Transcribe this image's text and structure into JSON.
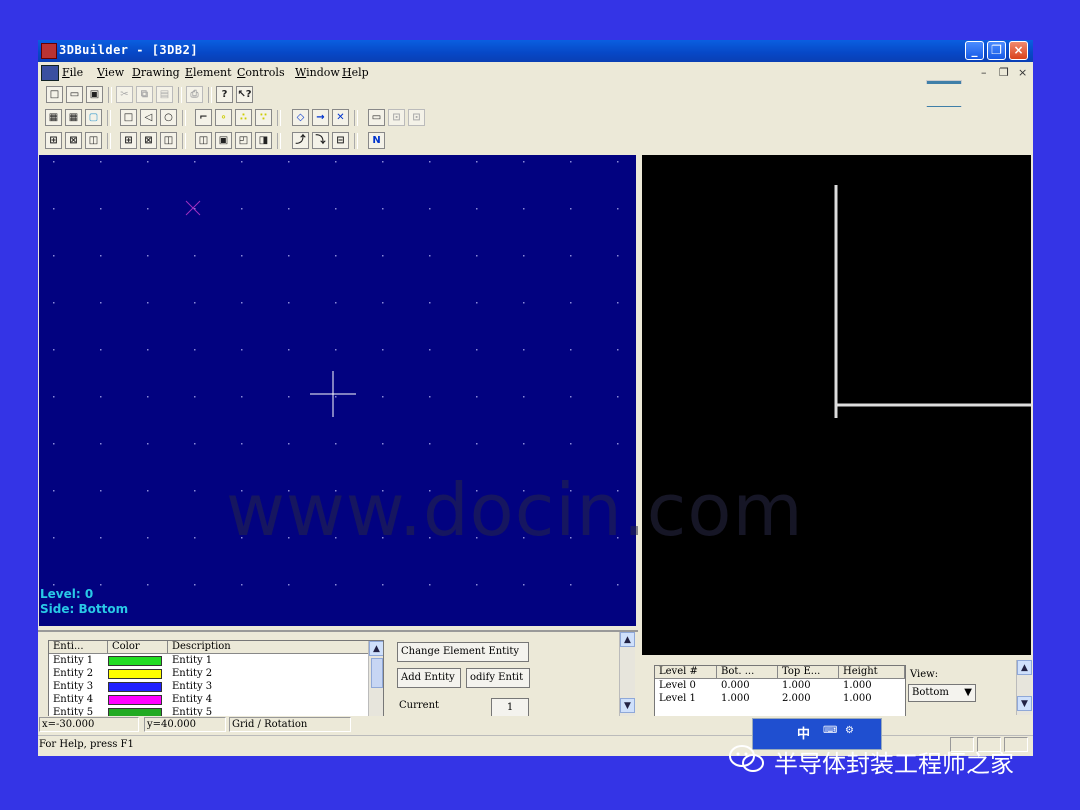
{
  "window": {
    "title": "3DBuilder - [3DB2]"
  },
  "menu": [
    "File",
    "View",
    "Drawing",
    "Element",
    "Controls",
    "Window",
    "Help"
  ],
  "menu_accel": [
    "F",
    "V",
    "D",
    "E",
    "C",
    "W",
    "H"
  ],
  "mdi_controls": {
    "minimize": "–",
    "restore": "❐",
    "close": "×"
  },
  "canvas_left": {
    "level_label": "Level: 0",
    "side_label": "Side: Bottom"
  },
  "entity_table": {
    "columns": [
      "Enti...",
      "Color",
      "Description"
    ],
    "rows": [
      {
        "name": "Entity 1",
        "color": "#22dd22",
        "description": "Entity 1"
      },
      {
        "name": "Entity 2",
        "color": "#ffff00",
        "description": "Entity 2"
      },
      {
        "name": "Entity 3",
        "color": "#2020ff",
        "description": "Entity 3"
      },
      {
        "name": "Entity 4",
        "color": "#ff00ff",
        "description": "Entity 4"
      },
      {
        "name": "Entity 5",
        "color": "#22aa22",
        "description": "Entity 5"
      }
    ]
  },
  "entity_buttons": {
    "change": "Change Element Entity",
    "add": "Add Entity",
    "modify": "odify Entit",
    "current_label": "Current",
    "current_value": "1"
  },
  "level_table": {
    "columns": [
      "Level #",
      "Bot. ...",
      "Top E...",
      "Height"
    ],
    "rows": [
      {
        "level": "Level 0",
        "bot": "0.000",
        "top": "1.000",
        "height": "1.000"
      },
      {
        "level": "Level 1",
        "bot": "1.000",
        "top": "2.000",
        "height": "1.000"
      }
    ]
  },
  "view": {
    "label": "View:",
    "value": "Bottom"
  },
  "status": {
    "x": "x=-30.000",
    "y": "y=40.000",
    "mode": "Grid / Rotation",
    "help": "For Help, press F1"
  },
  "watermark": "www.docin.com",
  "caption": "半导体封装工程师之家",
  "ime_label": "中"
}
